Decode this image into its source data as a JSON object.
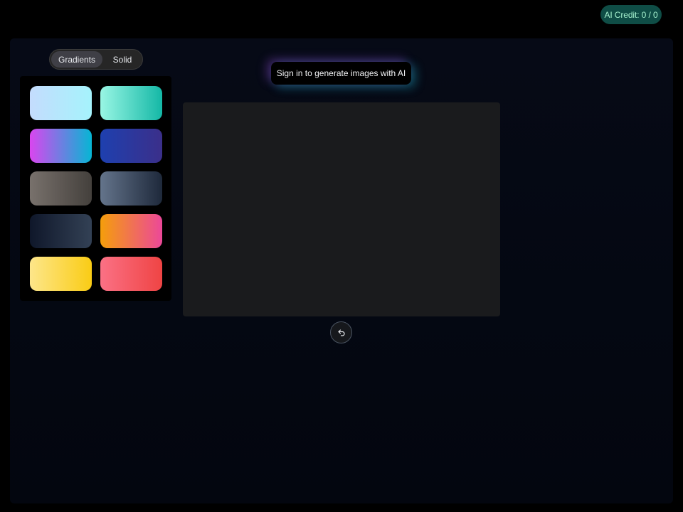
{
  "header": {
    "credit_label": "AI Credit: 0 / 0"
  },
  "background_toggle": {
    "options": [
      "Gradients",
      "Solid"
    ],
    "selected": "Gradients"
  },
  "ai_banner": {
    "text": "Sign in to generate images with AI"
  },
  "gradient_swatches": [
    {
      "from": "#c4dcfd",
      "to": "#a5f3fc"
    },
    {
      "from": "#99f6e4",
      "to": "#14b8a6"
    },
    {
      "from": "#d946ef",
      "to": "#06b6d4"
    },
    {
      "from": "#1e40af",
      "to": "#3b2f8a"
    },
    {
      "from": "#78716c",
      "to": "#44403c"
    },
    {
      "from": "#64748b",
      "to": "#1e293b"
    },
    {
      "from": "#0f172a",
      "to": "#334155"
    },
    {
      "from": "#f59e0b",
      "to": "#ec4899"
    },
    {
      "from": "#fde68a",
      "to": "#facc15"
    },
    {
      "from": "#fb7185",
      "to": "#ef4444"
    }
  ],
  "icons": {
    "undo": "undo-icon"
  },
  "colors": {
    "credit_badge_bg": "#0f4d46",
    "canvas_bg": "#1a1b1d"
  }
}
